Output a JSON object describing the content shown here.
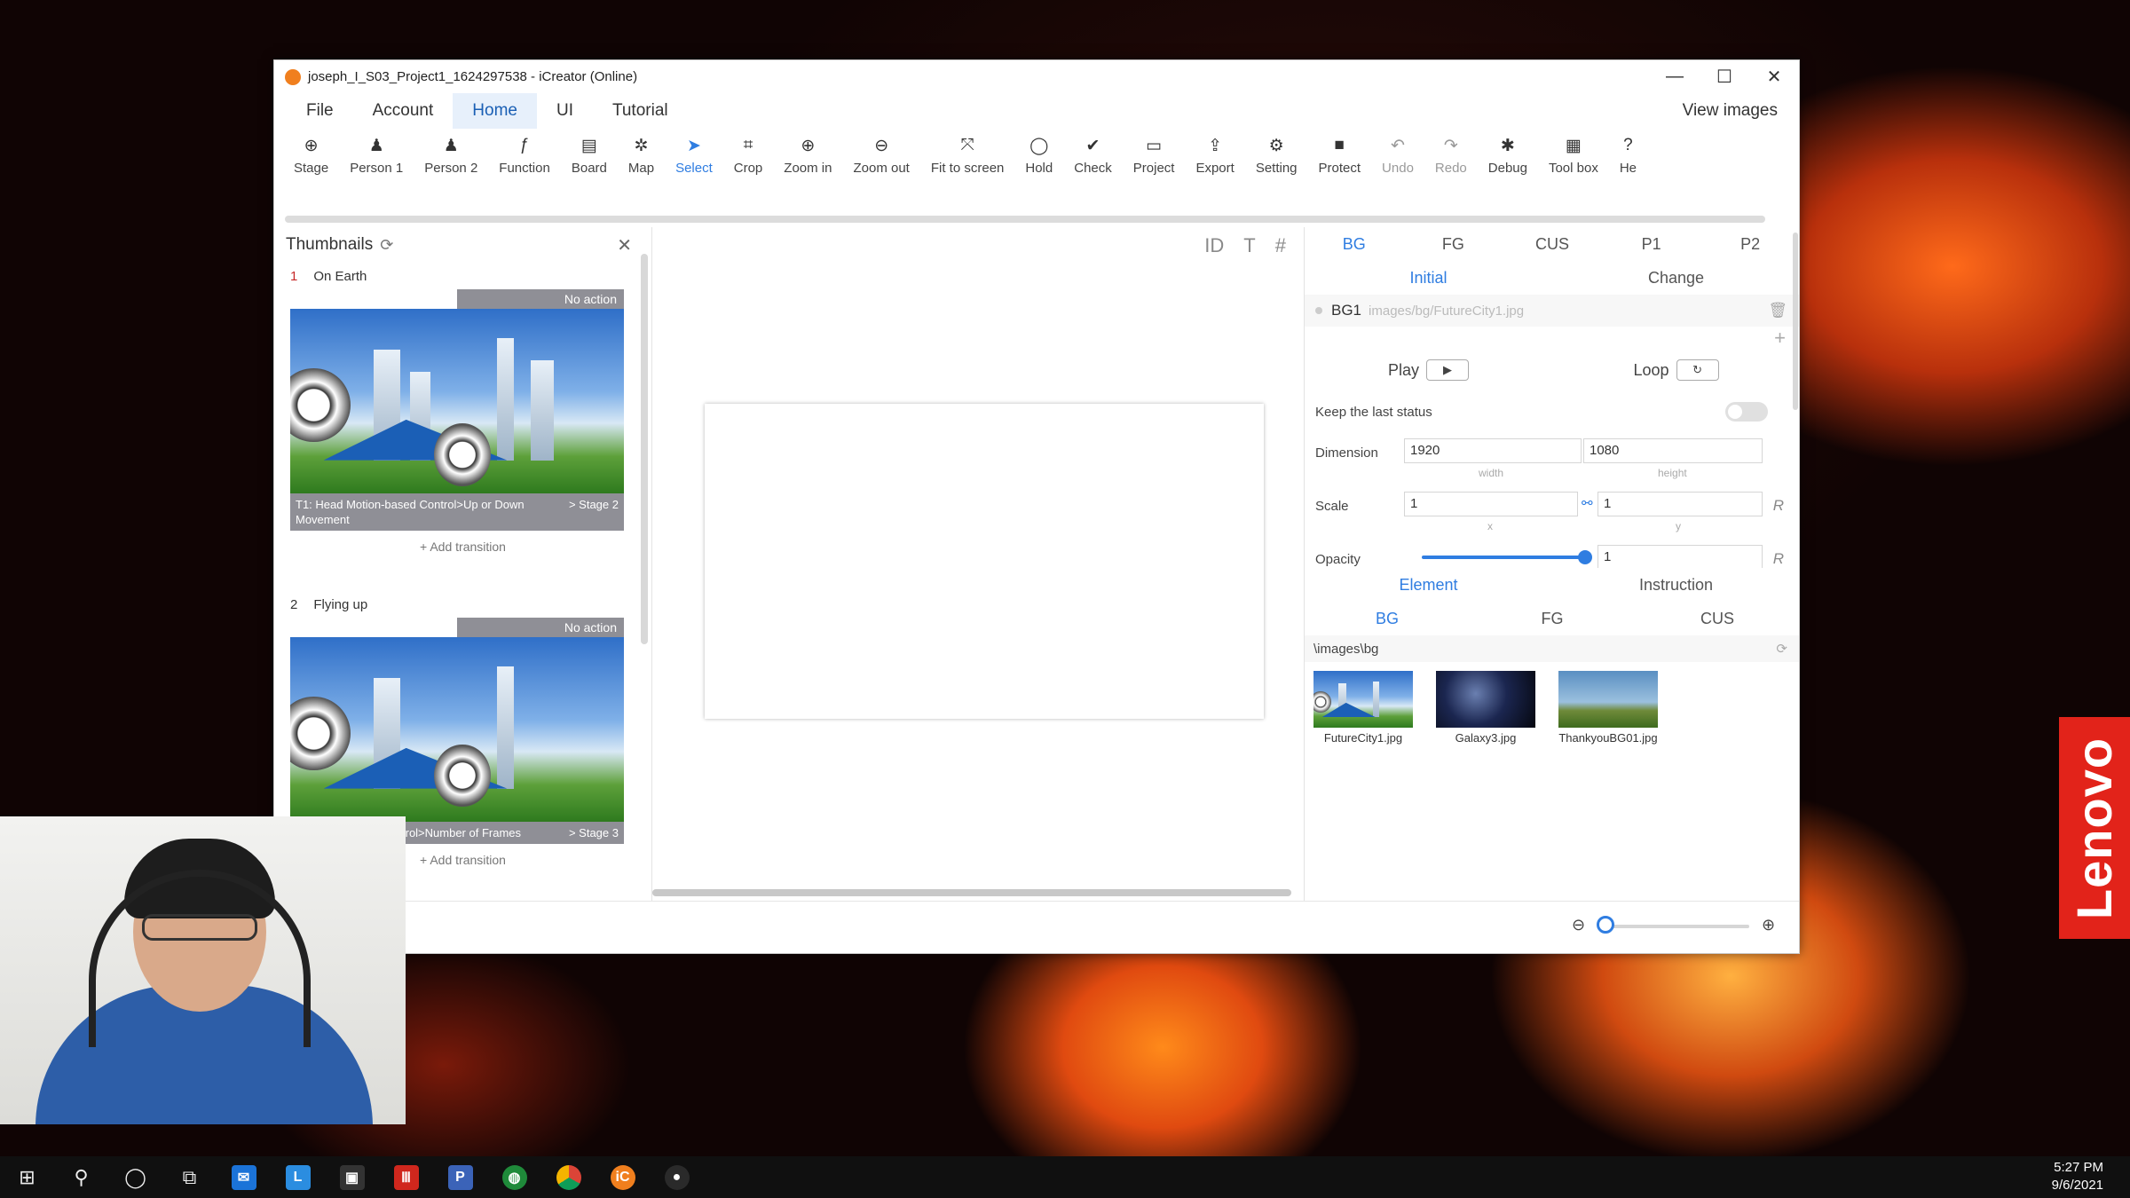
{
  "window": {
    "title": "joseph_I_S03_Project1_1624297538 - iCreator (Online)",
    "controls": {
      "minimize": "—",
      "maximize": "☐",
      "close": "✕"
    }
  },
  "menu": {
    "items": [
      "File",
      "Account",
      "Home",
      "UI",
      "Tutorial"
    ],
    "active": "Home",
    "view_images": "View images"
  },
  "toolbar": [
    {
      "label": "Stage",
      "icon": "stage-icon",
      "glyph": "⊕"
    },
    {
      "label": "Person 1",
      "icon": "person-icon",
      "glyph": "♟"
    },
    {
      "label": "Person 2",
      "icon": "person-icon",
      "glyph": "♟"
    },
    {
      "label": "Function",
      "icon": "function-icon",
      "glyph": "ƒ"
    },
    {
      "label": "Board",
      "icon": "board-icon",
      "glyph": "▤"
    },
    {
      "label": "Map",
      "icon": "map-icon",
      "glyph": "✲"
    },
    {
      "label": "Select",
      "icon": "cursor-icon",
      "glyph": "➤"
    },
    {
      "label": "Crop",
      "icon": "crop-icon",
      "glyph": "⌗"
    },
    {
      "label": "Zoom in",
      "icon": "zoom-in-icon",
      "glyph": "⊕"
    },
    {
      "label": "Zoom out",
      "icon": "zoom-out-icon",
      "glyph": "⊖"
    },
    {
      "label": "Fit to screen",
      "icon": "fit-icon",
      "glyph": "⤧"
    },
    {
      "label": "Hold",
      "icon": "hold-icon",
      "glyph": "◯"
    },
    {
      "label": "Check",
      "icon": "check-icon",
      "glyph": "✔"
    },
    {
      "label": "Project",
      "icon": "folder-icon",
      "glyph": "▭"
    },
    {
      "label": "Export",
      "icon": "export-icon",
      "glyph": "⇪"
    },
    {
      "label": "Setting",
      "icon": "gear-icon",
      "glyph": "⚙"
    },
    {
      "label": "Protect",
      "icon": "lock-icon",
      "glyph": "■"
    },
    {
      "label": "Undo",
      "icon": "undo-icon",
      "glyph": "↶"
    },
    {
      "label": "Redo",
      "icon": "redo-icon",
      "glyph": "↷"
    },
    {
      "label": "Debug",
      "icon": "bug-icon",
      "glyph": "✱"
    },
    {
      "label": "Tool box",
      "icon": "toolbox-icon",
      "glyph": "▦"
    },
    {
      "label": "He",
      "icon": "help-icon",
      "glyph": "?"
    }
  ],
  "thumbnails": {
    "title": "Thumbnails",
    "scenes": [
      {
        "num": "1",
        "name": "On Earth",
        "status": "No action",
        "caption": "T1: Head Motion-based Control>Up or Down Movement",
        "stage": "> Stage 2",
        "add_transition": "Add transition"
      },
      {
        "num": "2",
        "name": "Flying up",
        "status": "No action",
        "caption": "trol>Number of Frames",
        "stage": "> Stage 3",
        "add_transition": "Add transition"
      }
    ]
  },
  "canvas_tools": [
    "ID",
    "T",
    "#"
  ],
  "props": {
    "tabs": [
      "BG",
      "FG",
      "CUS",
      "P1",
      "P2"
    ],
    "active_tab": "BG",
    "subtabs": [
      "Initial",
      "Change"
    ],
    "bg_item": {
      "name": "BG1",
      "path": "images/bg/FutureCity1.jpg"
    },
    "play": "Play",
    "loop": "Loop",
    "keep_last": "Keep the last status",
    "dimension": {
      "label": "Dimension",
      "width": "1920",
      "height": "1080",
      "width_label": "width",
      "height_label": "height"
    },
    "scale": {
      "label": "Scale",
      "x": "1",
      "y": "1",
      "x_label": "x",
      "y_label": "y"
    },
    "opacity": {
      "label": "Opacity",
      "value": "1"
    },
    "r_label": "R",
    "lower_tabs": [
      "Element",
      "Instruction"
    ],
    "lower_subtabs": [
      "BG",
      "FG",
      "CUS"
    ],
    "folder": "\\images\\bg",
    "assets": [
      "FutureCity1.jpg",
      "Galaxy3.jpg",
      "ThankyouBG01.jpg"
    ]
  },
  "taskbar": {
    "time": "5:27 PM",
    "date": "9/6/2021"
  },
  "brand": "Lenovo",
  "colors": {
    "accent": "#2f7de1",
    "selected_border": "#ff6b6b",
    "brand": "#e2231a"
  }
}
